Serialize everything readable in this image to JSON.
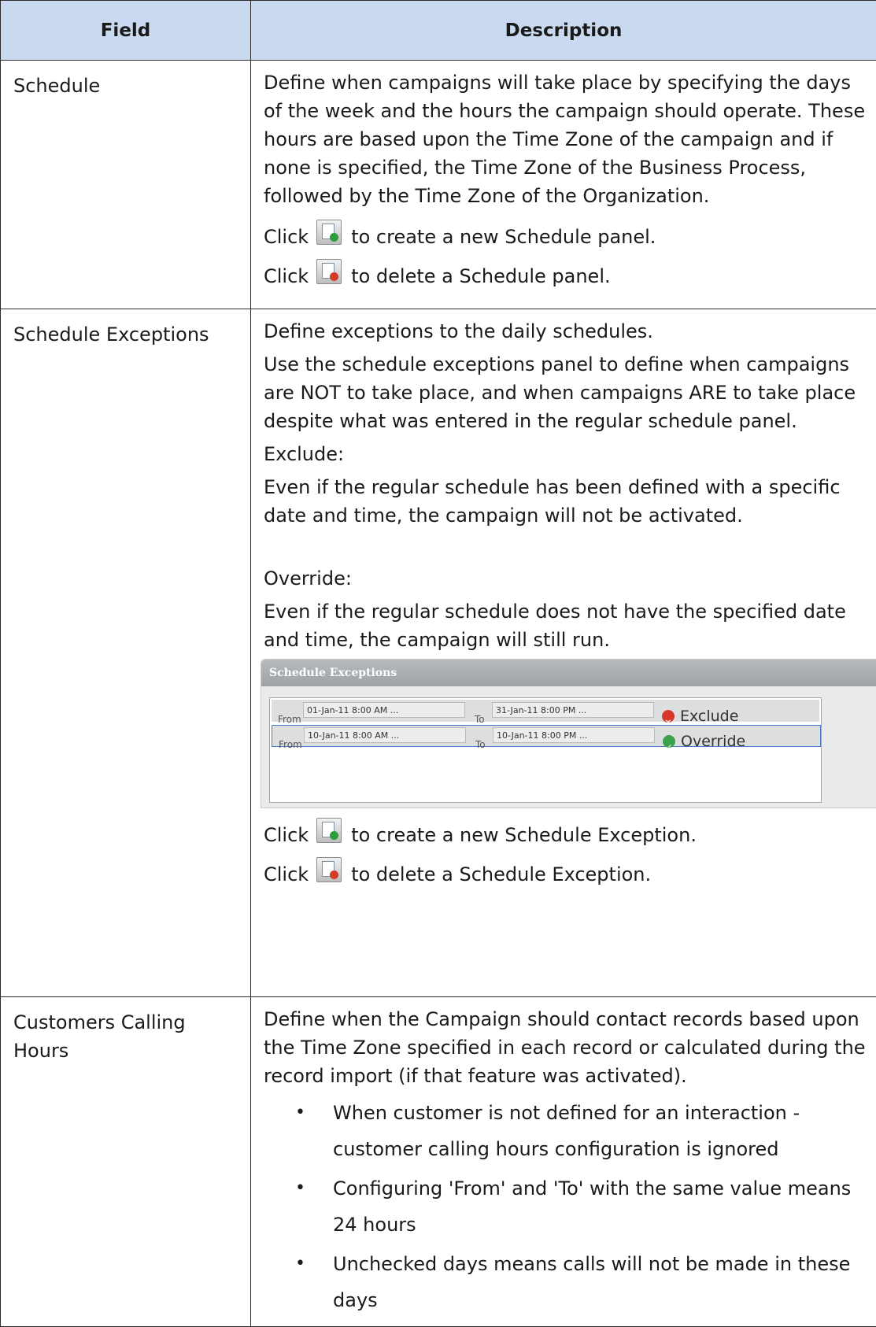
{
  "header": {
    "field": "Field",
    "description": "Description"
  },
  "rows": [
    {
      "field": "Schedule",
      "paragraphs": [
        "Define when campaigns will take place by specifying the days of the week and the hours the campaign should operate. These hours are based upon the Time Zone of the campaign and if none is specified, the Time Zone of the Business Process, followed by the Time Zone of the Organization."
      ],
      "click_word": "Click",
      "add_text": "to create a new Schedule panel.",
      "delete_text": "to delete a Schedule panel."
    },
    {
      "field": "Schedule Exceptions",
      "p1": "Define exceptions to the daily schedules.",
      "p2": "Use the schedule exceptions panel to define when campaigns are NOT to take place, and when campaigns ARE to take place despite what was entered in the regular schedule panel.",
      "p3": "Exclude:",
      "p4": "Even if the regular schedule has been defined with a specific date and time, the campaign will not be activated.",
      "p5": "Override:",
      "p6": "Even if the regular schedule does not have the specified date and time, the campaign will still run.",
      "panel": {
        "title": "Schedule Exceptions",
        "rows": [
          {
            "from_label": "From",
            "from_value": "01-Jan-11 8:00 AM ...",
            "to_label": "To",
            "to_value": "31-Jan-11 8:00 PM ...",
            "status": "Exclude",
            "status_icon": "x-circle-icon"
          },
          {
            "from_label": "From",
            "from_value": "10-Jan-11 8:00 AM ...",
            "to_label": "To",
            "to_value": "10-Jan-11 8:00 PM ...",
            "status": "Override",
            "status_icon": "check-circle-icon"
          }
        ]
      },
      "click_word": "Click",
      "add_text": "to create a new Schedule Exception.",
      "delete_text": "to delete a Schedule Exception."
    },
    {
      "field": "Customers Calling Hours",
      "p1": "Define when the Campaign should contact records based upon the Time Zone specified in each record or calculated during the record import (if that feature was activated).",
      "bullets": [
        "When customer is not defined for an interaction - customer calling hours configuration is ignored",
        "Configuring 'From' and 'To' with the same value means 24 hours",
        "Unchecked days means calls will not be made in these days"
      ]
    }
  ]
}
